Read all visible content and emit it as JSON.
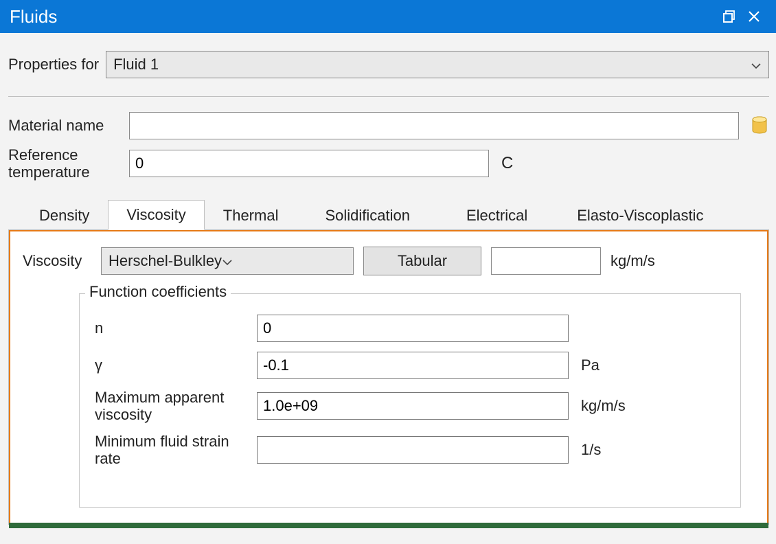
{
  "window": {
    "title": "Fluids"
  },
  "properties": {
    "label": "Properties for",
    "selected": "Fluid 1"
  },
  "material": {
    "label": "Material name",
    "value": ""
  },
  "ref_temp": {
    "label": "Reference temperature",
    "value": "0",
    "unit": "C"
  },
  "tabs": [
    {
      "label": "Density"
    },
    {
      "label": "Viscosity"
    },
    {
      "label": "Thermal"
    },
    {
      "label": "Solidification"
    },
    {
      "label": "Electrical"
    },
    {
      "label": "Elasto-Viscoplastic"
    }
  ],
  "viscosity": {
    "label": "Viscosity",
    "model": "Herschel-Bulkley",
    "tabular_label": "Tabular",
    "value": "",
    "unit": "kg/m/s"
  },
  "coefficients": {
    "legend": "Function coefficients",
    "rows": [
      {
        "label": "n",
        "value": "0",
        "unit": ""
      },
      {
        "label": "γ",
        "value": "-0.1",
        "unit": "Pa"
      },
      {
        "label": "Maximum apparent viscosity",
        "value": "1.0e+09",
        "unit": "kg/m/s"
      },
      {
        "label": "Minimum fluid strain rate",
        "value": "",
        "unit": "1/s"
      }
    ]
  }
}
